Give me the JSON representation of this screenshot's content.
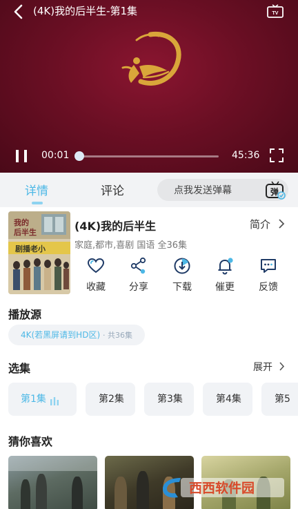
{
  "player": {
    "title": "(4K)我的后半生-第1集",
    "current_time": "00:01",
    "total_time": "45:36",
    "progress_fraction": 0.0,
    "icons": [
      "back-arrow-icon",
      "tv-cast-icon",
      "pause-icon",
      "fullscreen-icon",
      "studio-logo"
    ]
  },
  "tabs": [
    {
      "label": "详情",
      "active": true
    },
    {
      "label": "评论",
      "active": false
    }
  ],
  "danmaku": {
    "placeholder": "点我发送弹幕",
    "icon_text": "弹"
  },
  "show": {
    "title": "(4K)我的后半生",
    "intro_label": "简介",
    "meta": "家庭,都市,喜剧 国语 全36集"
  },
  "actions": [
    {
      "label": "收藏",
      "icon": "heart-icon"
    },
    {
      "label": "分享",
      "icon": "share-icon"
    },
    {
      "label": "下载",
      "icon": "download-icon"
    },
    {
      "label": "催更",
      "icon": "bell-icon"
    },
    {
      "label": "反馈",
      "icon": "feedback-icon"
    }
  ],
  "source": {
    "section_title": "播放源",
    "name": "4K(若黑屏请到HD区)",
    "count": "· 共36集"
  },
  "episodes": {
    "section_title": "选集",
    "expand_label": "展开",
    "items": [
      "第1集",
      "第2集",
      "第3集",
      "第4集",
      "第5"
    ]
  },
  "recommend": {
    "section_title": "猜你喜欢"
  },
  "watermark": {
    "text": "西西软件园"
  },
  "colors": {
    "accent": "#4db8e6",
    "player_bg": "#6b0f24",
    "logo_gold": "#d9a63a"
  }
}
